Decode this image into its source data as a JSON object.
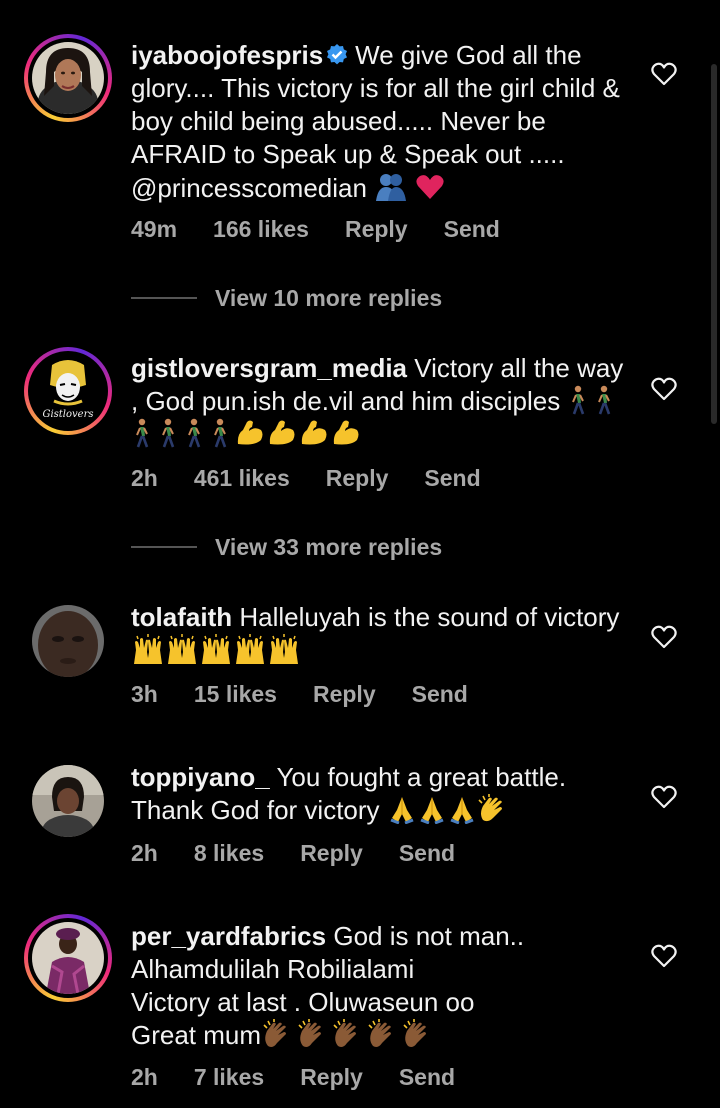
{
  "comments": [
    {
      "username": "iyaboojofespris",
      "verified": true,
      "text": "We give God all the glory.... This victory is for all the girl child & boy child being abused..... Never be AFRAID to Speak up & Speak out ..... @princesscomedian",
      "emojis": [
        "people-hugging",
        "red-heart"
      ],
      "time": "49m",
      "likes": "166 likes",
      "reply": "Reply",
      "send": "Send",
      "story_ring": true,
      "view_replies": "View 10 more replies"
    },
    {
      "username": "gistloversgram_media",
      "verified": false,
      "text": "Victory all the way , God pun.ish de.vil and him disciples",
      "emojis": [
        "person-walking-x6",
        "flexed-biceps-x4"
      ],
      "avatar_text": "Gistlovers",
      "time": "2h",
      "likes": "461 likes",
      "reply": "Reply",
      "send": "Send",
      "story_ring": true,
      "view_replies": "View 33 more replies"
    },
    {
      "username": "tolafaith",
      "verified": false,
      "text": "Halleluyah is the sound of victory",
      "emojis": [
        "raising-hands-x5"
      ],
      "time": "3h",
      "likes": "15 likes",
      "reply": "Reply",
      "send": "Send",
      "story_ring": false
    },
    {
      "username": "toppiyano_",
      "verified": false,
      "text": "You fought a great battle. Thank God for victory",
      "emojis": [
        "folded-hands-x3",
        "clapping-hands"
      ],
      "time": "2h",
      "likes": "8 likes",
      "reply": "Reply",
      "send": "Send",
      "story_ring": false
    },
    {
      "username": "per_yardfabrics",
      "verified": false,
      "text_lines": [
        "God is not man..",
        "Alhamdulilah Robilialami",
        "Victory at last . Oluwaseun oo",
        "Great mum"
      ],
      "emojis": [
        "clapping-hands-medium-dark-x5"
      ],
      "time": "2h",
      "likes": "7 likes",
      "reply": "Reply",
      "send": "Send",
      "story_ring": true
    }
  ],
  "colors": {
    "background": "#000000",
    "text": "#f2f2f2",
    "meta": "#a8a8a8",
    "verified": "#3897f0",
    "heart_emoji": "#e0245e"
  },
  "icons": {
    "like": "heart-outline-icon",
    "verified": "verified-badge-icon"
  }
}
